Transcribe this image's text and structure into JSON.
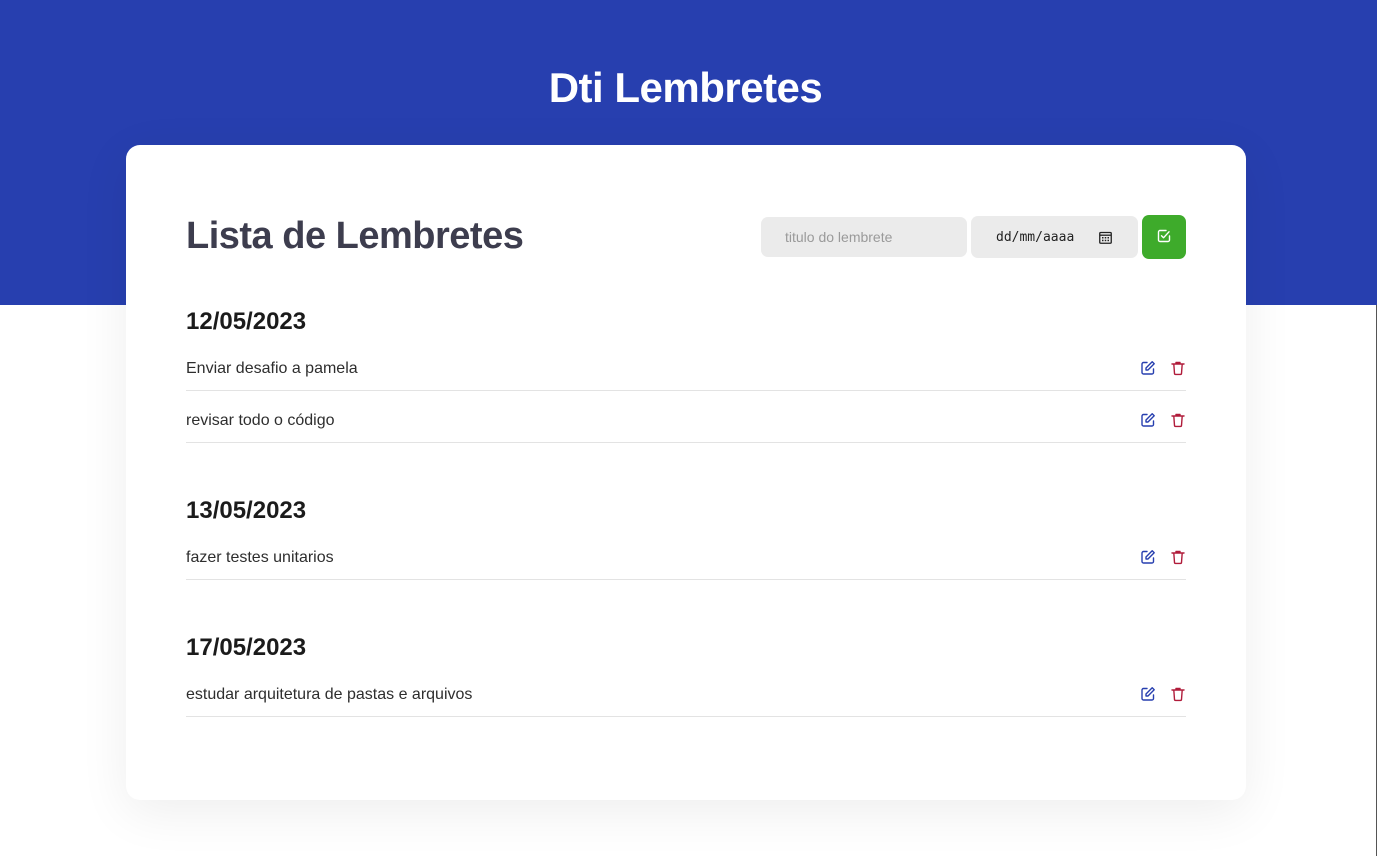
{
  "app": {
    "title": "Dti Lembretes"
  },
  "colors": {
    "primary": "#273faf",
    "success": "#3eab2b",
    "danger": "#b01b3a",
    "edit": "#273faf"
  },
  "list": {
    "title": "Lista de Lembretes",
    "form": {
      "title_placeholder": "titulo do lembrete",
      "date_placeholder": "dd/mm/aaaa",
      "date_icon": "calendar-icon",
      "submit_icon": "check-square-icon"
    },
    "groups": [
      {
        "date": "12/05/2023",
        "items": [
          {
            "text": "Enviar desafio a pamela"
          },
          {
            "text": "revisar todo o código"
          }
        ]
      },
      {
        "date": "13/05/2023",
        "items": [
          {
            "text": "fazer testes unitarios"
          }
        ]
      },
      {
        "date": "17/05/2023",
        "items": [
          {
            "text": "estudar arquitetura de pastas e arquivos"
          }
        ]
      }
    ],
    "item_actions": {
      "edit_icon": "edit-icon",
      "delete_icon": "trash-icon"
    }
  }
}
